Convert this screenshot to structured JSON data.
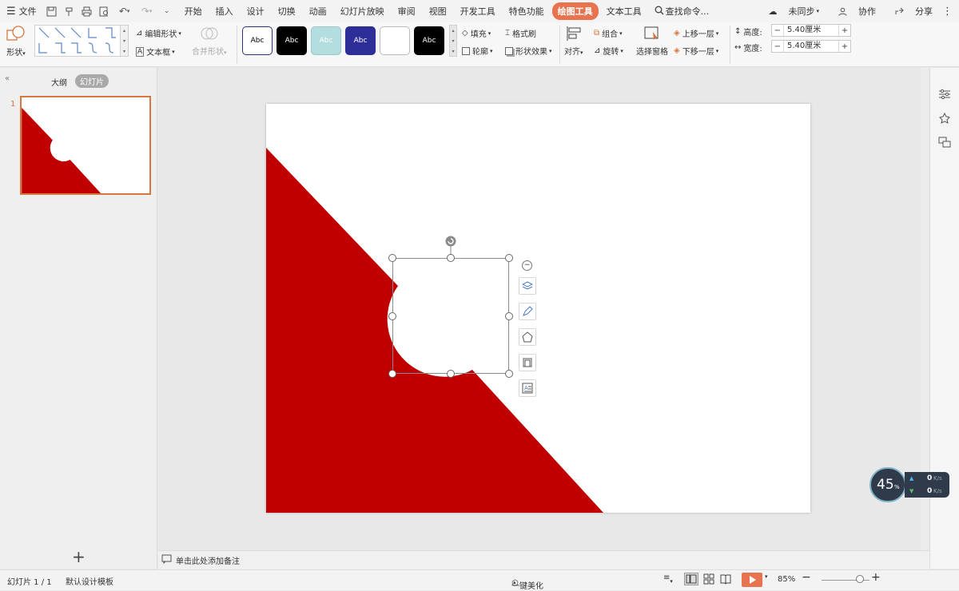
{
  "menubar": {
    "file_label": "文件",
    "tabs": [
      "开始",
      "插入",
      "设计",
      "切换",
      "动画",
      "幻灯片放映",
      "审阅",
      "视图",
      "开发工具",
      "特色功能",
      "绘图工具",
      "文本工具"
    ],
    "active_tab": "绘图工具",
    "search_label": "查找命令...",
    "sync_label": "未同步",
    "collab_label": "协作",
    "share_label": "分享"
  },
  "ribbon": {
    "shape_label": "形状",
    "edit_shape_label": "编辑形状",
    "text_box_label": "文本框",
    "merge_shape_label": "合并形状",
    "style_samples": [
      "Abc",
      "Abc",
      "Abc",
      "Abc",
      "",
      "Abc"
    ],
    "fill_label": "填充",
    "format_painter_label": "格式刷",
    "outline_label": "轮廓",
    "shape_effect_label": "形状效果",
    "align_label": "对齐",
    "group_label": "组合",
    "rotate_label": "旋转",
    "selection_pane_label": "选择窗格",
    "bring_forward_label": "上移一层",
    "send_backward_label": "下移一层",
    "height_label": "高度:",
    "height_value": "5.40厘米",
    "width_label": "宽度:",
    "width_value": "5.40厘米"
  },
  "leftpanel": {
    "outline_tab": "大纲",
    "slides_tab": "幻灯片",
    "slide_number": "1"
  },
  "notes": {
    "placeholder": "单击此处添加备注"
  },
  "statusbar": {
    "slide_info": "幻灯片 1 / 1",
    "template": "默认设计模板",
    "beautify": "一键美化",
    "zoom": "85%"
  },
  "netwidget": {
    "percent": "45",
    "percent_unit": "%",
    "up": "0",
    "down": "0",
    "unit": "K/s"
  },
  "colors": {
    "accent": "#e8744f",
    "slide_red": "#c00000",
    "thumb_border": "#d6773d"
  }
}
